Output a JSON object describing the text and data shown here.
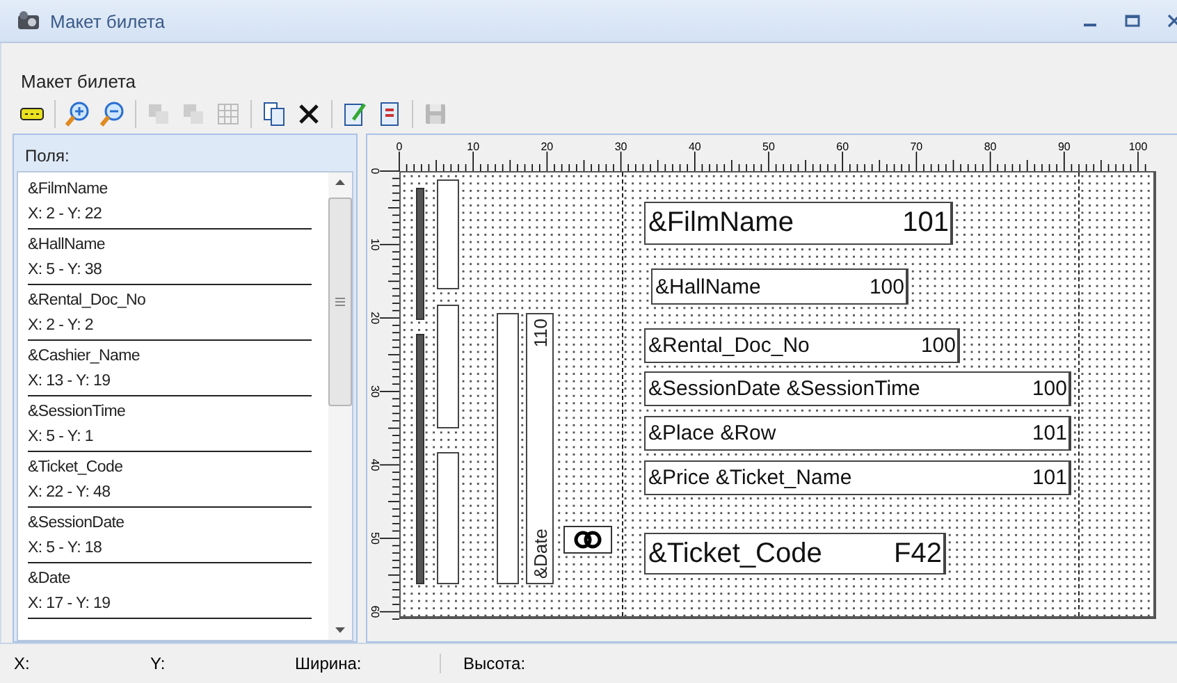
{
  "window": {
    "title": "Макет билета"
  },
  "form_title": "Макет билета",
  "toolbar": [
    {
      "disabled": false
    },
    {
      "disabled": false
    },
    {
      "disabled": false
    },
    {
      "disabled": true
    },
    {
      "disabled": true
    },
    {
      "disabled": true
    },
    {
      "disabled": false
    },
    {
      "disabled": false
    },
    {
      "disabled": false
    },
    {
      "disabled": false
    },
    {
      "disabled": true
    }
  ],
  "fields_panel": {
    "header": "Поля:",
    "items": [
      {
        "name": "&FilmName",
        "position": "X: 2 - Y: 22"
      },
      {
        "name": "&HallName",
        "position": "X: 5 - Y: 38"
      },
      {
        "name": "&Rental_Doc_No",
        "position": "X: 2 - Y: 2"
      },
      {
        "name": "&Cashier_Name",
        "position": "X: 13 - Y: 19"
      },
      {
        "name": "&SessionTime",
        "position": "X: 5 - Y: 1"
      },
      {
        "name": "&Ticket_Code",
        "position": "X: 22 - Y: 48"
      },
      {
        "name": "&SessionDate",
        "position": "X: 5 - Y: 18"
      },
      {
        "name": "&Date",
        "position": "X: 17 - Y: 19"
      }
    ]
  },
  "ruler": {
    "top_labels": [
      "0",
      "10",
      "20",
      "30",
      "40",
      "50",
      "60",
      "70",
      "80",
      "90",
      "100"
    ],
    "left_labels": [
      "0",
      "10",
      "20",
      "30",
      "40",
      "50",
      "60"
    ]
  },
  "canvas": {
    "fields": [
      {
        "text": "&FilmName",
        "size": "101"
      },
      {
        "text": "&HallName",
        "size": "100"
      },
      {
        "text": "&Rental_Doc_No",
        "size": "100"
      },
      {
        "text": "&SessionDate &SessionTime",
        "size": "100"
      },
      {
        "text": "&Place &Row",
        "size": "101"
      },
      {
        "text": "&Price &Ticket_Name",
        "size": "101"
      },
      {
        "text": "&Ticket_Code",
        "size": "F42"
      }
    ],
    "vertical_fields": [
      {
        "text": "&Date",
        "size": "110"
      }
    ]
  },
  "status_bar": [
    "X:",
    "Y:",
    "Ширина:",
    "Высота:"
  ]
}
